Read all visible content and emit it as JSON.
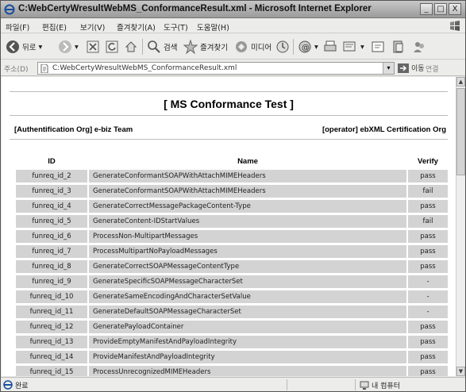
{
  "window": {
    "title": "C:WebCertyWresultWebMS_ConformanceResult.xml - Microsoft Internet Explorer",
    "min_label": "_",
    "max_label": "□",
    "close_label": "X"
  },
  "menu": [
    "파일(F)",
    "편집(E)",
    "보기(V)",
    "즐겨찾기(A)",
    "도구(T)",
    "도움말(H)"
  ],
  "toolbar": {
    "back_label": "뒤로",
    "search_label": "검색",
    "favorites_label": "즐겨찾기",
    "media_label": "미디어"
  },
  "address": {
    "label": "주소(D)",
    "url": "C:WebCertyWresultWebMS_ConformanceResult.xml",
    "go_label": "이동",
    "links_label": "연결"
  },
  "page": {
    "title": "[ MS Conformance Test ]",
    "org_left": "[Authentification Org] e-biz Team",
    "org_right": "[operator] ebXML Certification Org"
  },
  "table": {
    "headers": {
      "id": "ID",
      "name": "Name",
      "verify": "Verify"
    },
    "rows": [
      {
        "id": "funreq_id_2",
        "name": "GenerateConformantSOAPWithAttachMIMEHeaders",
        "verify": "pass"
      },
      {
        "id": "funreq_id_3",
        "name": "GenerateConformantSOAPWithAttachMIMEHeaders",
        "verify": "fail"
      },
      {
        "id": "funreq_id_4",
        "name": "GenerateCorrectMessagePackageContent-Type",
        "verify": "pass"
      },
      {
        "id": "funreq_id_5",
        "name": "GenerateContent-IDStartValues",
        "verify": "fail"
      },
      {
        "id": "funreq_id_6",
        "name": "ProcessNon-MultipartMessages",
        "verify": "pass"
      },
      {
        "id": "funreq_id_7",
        "name": "ProcessMultipartNoPayloadMessages",
        "verify": "pass"
      },
      {
        "id": "funreq_id_8",
        "name": "GenerateCorrectSOAPMessageContentType",
        "verify": "pass"
      },
      {
        "id": "funreq_id_9",
        "name": "GenerateSpecificSOAPMessageCharacterSet",
        "verify": "-"
      },
      {
        "id": "funreq_id_10",
        "name": "GenerateSameEncodingAndCharacterSetValue",
        "verify": "-"
      },
      {
        "id": "funreq_id_11",
        "name": "GenerateDefaultSOAPMessageCharacterSet",
        "verify": "-"
      },
      {
        "id": "funreq_id_12",
        "name": "GeneratePayloadContainer",
        "verify": "pass"
      },
      {
        "id": "funreq_id_13",
        "name": "ProvideEmptyManifestAndPayloadIntegrity",
        "verify": "pass"
      },
      {
        "id": "funreq_id_14",
        "name": "ProvideManifestAndPayloadIntegrity",
        "verify": "pass"
      },
      {
        "id": "funreq_id_15",
        "name": "ProcessUnrecognizedMIMEHeaders",
        "verify": "pass"
      }
    ]
  },
  "status": {
    "text": "완료",
    "zone": "내 컴퓨터"
  }
}
